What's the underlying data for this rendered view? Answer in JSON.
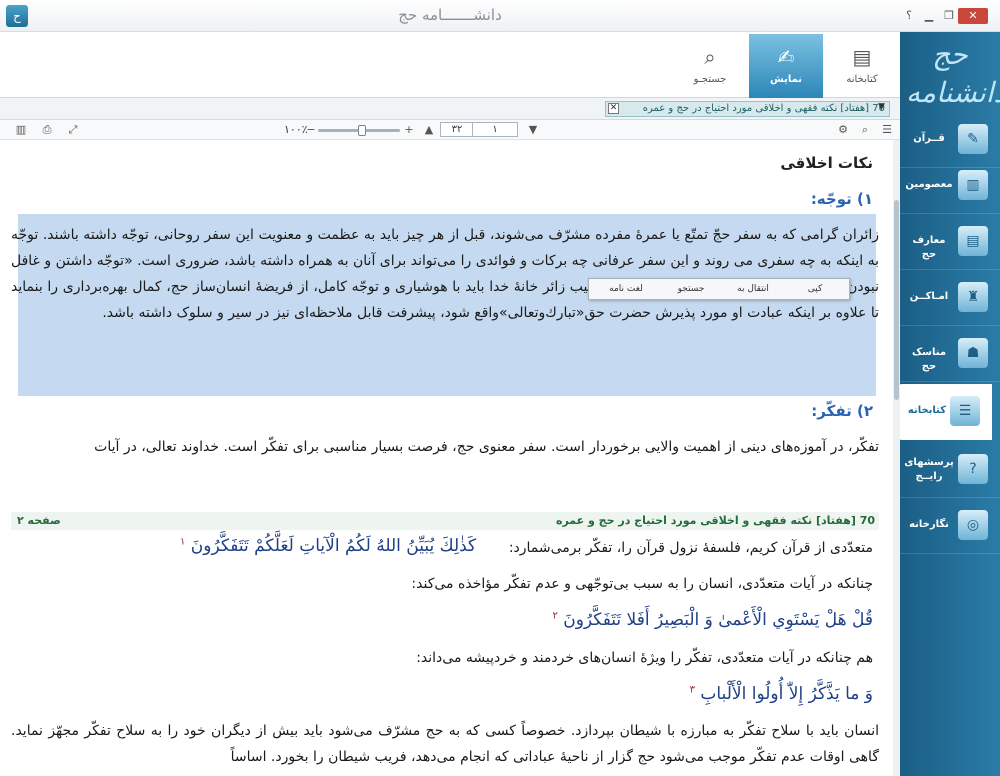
{
  "window": {
    "title": "دانشـــــــامه حج",
    "help": "؟",
    "close": "✕"
  },
  "sidebar": {
    "logo": "حج\nدانشنامه",
    "items": [
      {
        "label": "قــرآن",
        "icon": "quran-book-icon"
      },
      {
        "label": "معصومین",
        "icon": "mosque-icon"
      },
      {
        "label": "معارف حج",
        "icon": "knowledge-book-icon"
      },
      {
        "label": "امـاکــن",
        "icon": "places-minaret-icon"
      },
      {
        "label": "مناسک حج",
        "icon": "pilgrim-icon"
      },
      {
        "label": "کتابخانه",
        "icon": "library-books-icon"
      },
      {
        "label": "پرسشهای رایــج",
        "icon": "faq-icon"
      },
      {
        "label": "نگارخانه",
        "icon": "gallery-icon"
      }
    ]
  },
  "tabs": [
    {
      "label": "کتابخانه",
      "icon": "books-icon"
    },
    {
      "label": "نمایش",
      "icon": "display-document-icon"
    },
    {
      "label": "جستجـو",
      "icon": "magnifier-icon"
    }
  ],
  "docbar": {
    "current": "70 [هفتاد] نکته فقهی و اخلاقی مورد احتیاج در حج و عمره"
  },
  "toolbar": {
    "zoom": "۱۰۰٪",
    "page_current": "۱",
    "page_total": "۳۲"
  },
  "context_menu": [
    "کپی",
    "انتقال به",
    "جستجو",
    "لغت نامه"
  ],
  "content": {
    "heading": "نکات اخلاقی",
    "section1_title": "۱) توجّه:",
    "section1_text": "زائران گرامی که به سفر حجّ تمتّع یا عمرهٔ مفرده مشرّف می‌شوند، قبل از هر چیز باید به عظمت و معنویت این سفر روحانی، توجّه داشته باشند. توجّه به اینکه به چه سفری می روند و این سفر عرفانی چه برکات و فوائدی را می‌تواند برای آنان به همراه داشته باشد، ضروری است. «توجّه داشتن و غافل نبودن»، اوّلین گام در سیر و سلوک است. بدین ترتیب زائر خانهٔ خدا باید با هوشیاری و توجّه کامل، از فریضهٔ انسان‌ساز حج، کمال بهره‌برداری را بنماید تا علاوه بر اینکه عبادت او مورد پذیرش حضرت حق«تبارك‌وتعالی»واقع شود، پیشرفت قابل ملاحظه‌ای نیز در سیر و سلوک داشته باشد.",
    "section2_title": "۲) تفکّر:",
    "section2_text": "تفکّر، در آموزه‌های دینی از اهمیت والایی برخوردار است. سفر معنوی حج، فرصت بسیار مناسبی برای تفکّر است. خداوند تعالی، در آیات",
    "page_sep_title": "70 [هفتاد] نکته فقهی و اخلاقی مورد احتیاج در حج و عمره",
    "page_sep_page": "صفحه ۲",
    "line1": "متعدّدی از قرآن کریم، فلسفهٔ نزول قرآن را، تفکّر برمی‌شمارد:",
    "quran1": "كَذٰلِكَ يُبَيِّنُ اللهُ لَكُمُ الْآياتِ لَعَلَّكُمْ تَتَفَكَّرُونَ",
    "fn1": "۱",
    "line2": "چنانکه در آیات متعدّدی، انسان را به سبب بی‌توجّهی و عدم تفکّر مؤاخذه می‌کند:",
    "quran2": "قُلْ هَلْ يَسْتَوِي الْأَعْمىٰ وَ الْبَصِيرُ أَفَلا تَتَفَكَّرُونَ",
    "fn2": "۲",
    "line3": "هم چنانکه در آیات متعدّدی، تفکّر را ویژهٔ انسان‌های خردمند و خردپیشه می‌داند:",
    "quran3": "وَ ما يَذَّكَّرُ إِلاّٰ أُولُوا الْأَلْبابِ",
    "fn3": "۳",
    "para_last": "انسان باید با سلاح تفکّر به مبارزه با شیطان بپردازد. خصوصاً کسی که به حج مشرّف می‌شود باید بیش از دیگران خود را به سلاح تفکّر مجهّز نماید. گاهی اوقات عدم تفکّر موجب می‌شود حج گزار از ناحیهٔ عباداتی که انجام می‌دهد، فریب شیطان را بخورد. اساساً"
  }
}
